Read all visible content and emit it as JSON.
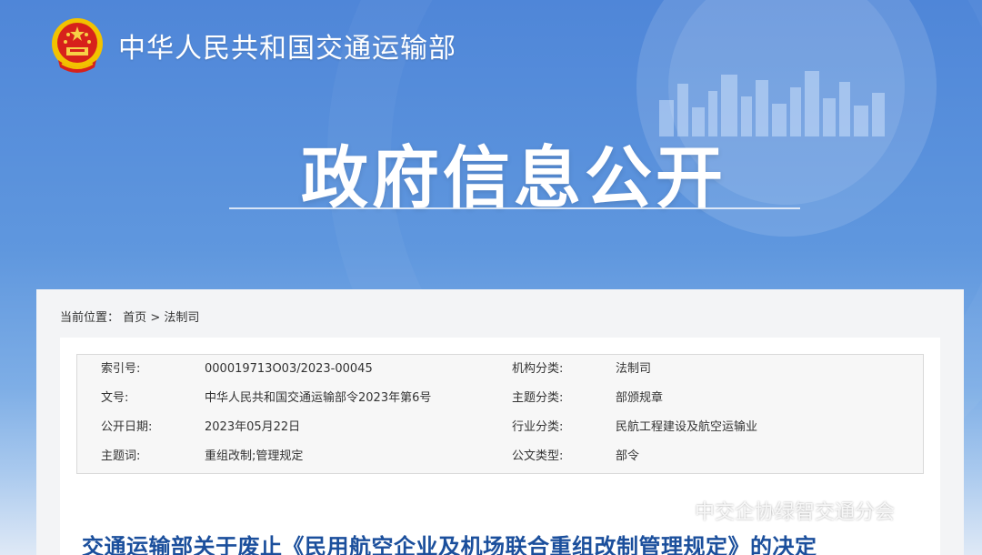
{
  "header": {
    "site_name": "中华人民共和国交通运输部",
    "section_title": "政府信息公开"
  },
  "breadcrumb": {
    "label": "当前位置：",
    "home": "首页",
    "separator": ">",
    "current": "法制司"
  },
  "metadata": {
    "rows": [
      {
        "k1": "索引号:",
        "v1": "000019713O03/2023-00045",
        "k2": "机构分类:",
        "v2": "法制司"
      },
      {
        "k1": "文号:",
        "v1": "中华人民共和国交通运输部令2023年第6号",
        "k2": "主题分类:",
        "v2": "部颁规章"
      },
      {
        "k1": "公开日期:",
        "v1": "2023年05月22日",
        "k2": "行业分类:",
        "v2": "民航工程建设及航空运输业"
      },
      {
        "k1": "主题词:",
        "v1": "重组改制;管理规定",
        "k2": "公文类型:",
        "v2": "部令"
      }
    ]
  },
  "document": {
    "title": "交通运输部关于废止《民用航空企业及机场联合重组改制管理规定》的决定"
  },
  "watermark": {
    "text": "中交企协绿智交通分会"
  },
  "colors": {
    "hero_blue": "#5f97de",
    "title_blue": "#1b4f9c",
    "panel_bg": "#f3f4f6"
  }
}
